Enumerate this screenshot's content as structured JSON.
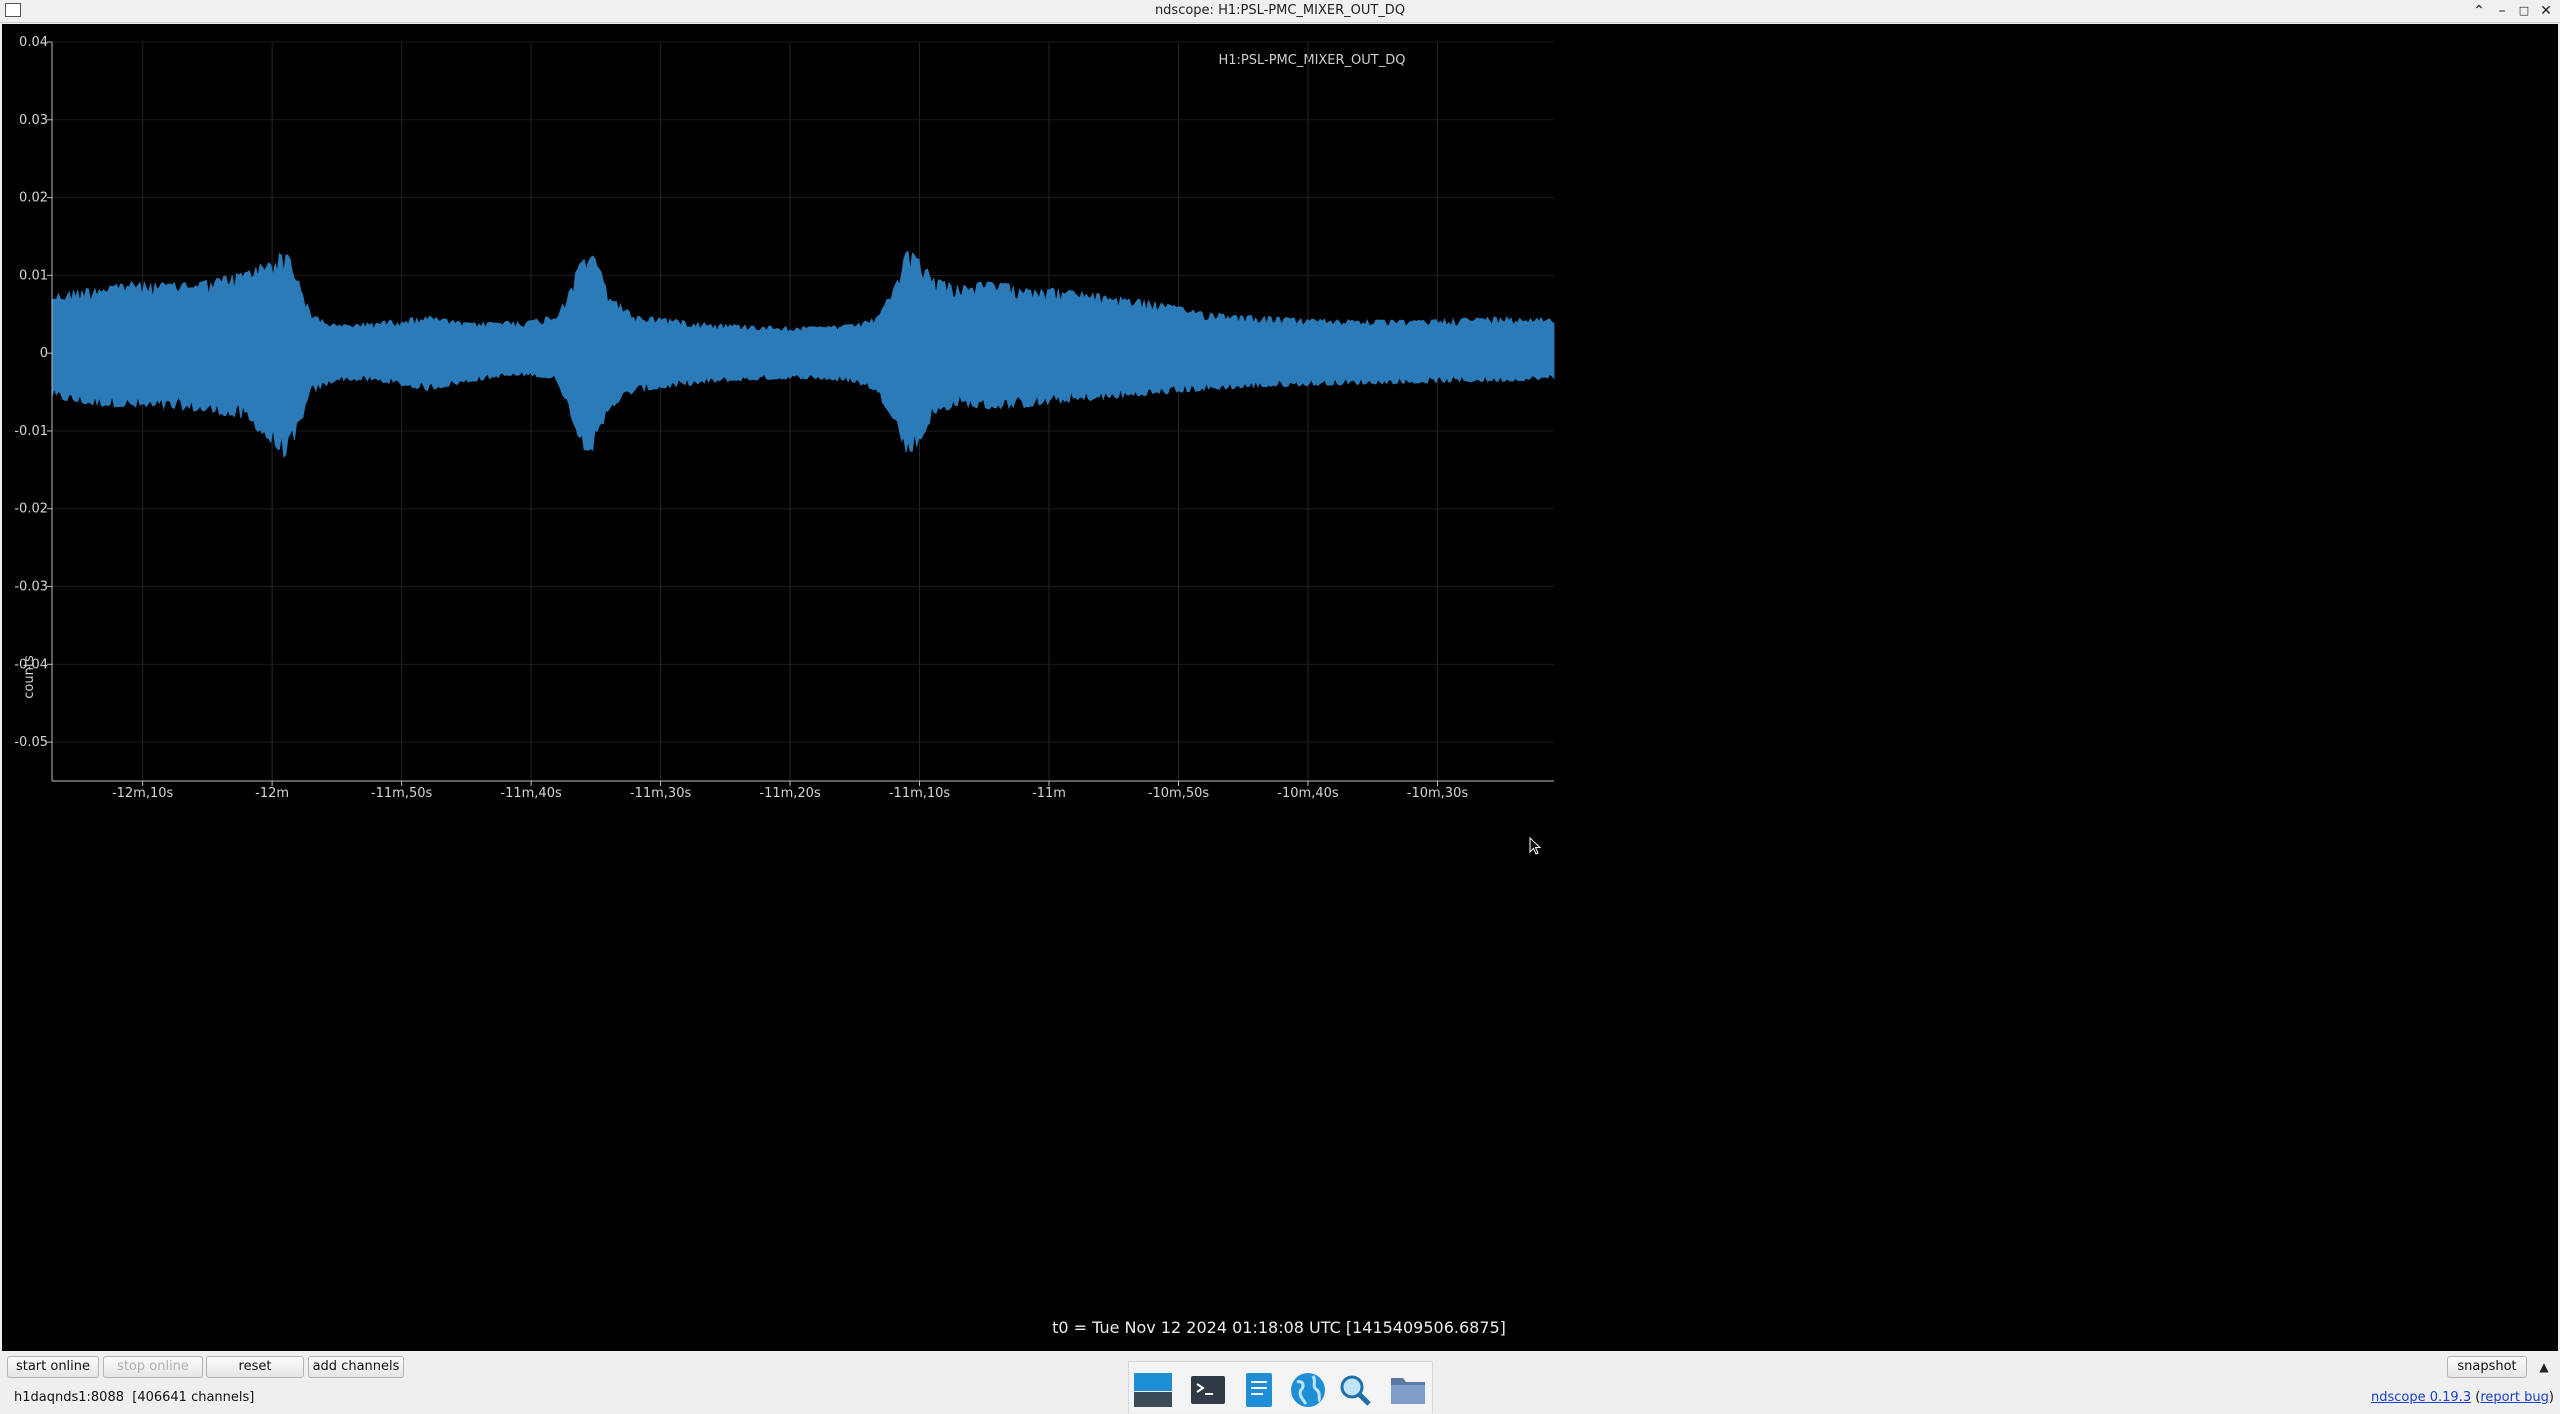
{
  "window": {
    "title": "ndscope: H1:PSL-PMC_MIXER_OUT_DQ"
  },
  "plot": {
    "channel_title": "H1:PSL-PMC_MIXER_OUT_DQ",
    "ylabel": "counts",
    "t0_label": "t0 = Tue Nov 12 2024 01:18:08 UTC [1415409506.6875]",
    "trace_color": "#2b7bb9",
    "background": "#000000"
  },
  "chart_data": {
    "type": "line",
    "title": "H1:PSL-PMC_MIXER_OUT_DQ",
    "ylabel": "counts",
    "xlabel": "t0 = Tue Nov 12 2024 01:18:08 UTC [1415409506.6875]",
    "ylim": [
      -0.055,
      0.04
    ],
    "xlim": [
      -737,
      -621
    ],
    "x_ticks": [
      {
        "value": -730,
        "label": "-12m,10s"
      },
      {
        "value": -720,
        "label": "-12m"
      },
      {
        "value": -710,
        "label": "-11m,50s"
      },
      {
        "value": -700,
        "label": "-11m,40s"
      },
      {
        "value": -690,
        "label": "-11m,30s"
      },
      {
        "value": -680,
        "label": "-11m,20s"
      },
      {
        "value": -670,
        "label": "-11m,10s"
      },
      {
        "value": -660,
        "label": "-11m"
      },
      {
        "value": -650,
        "label": "-10m,50s"
      },
      {
        "value": -640,
        "label": "-10m,40s"
      },
      {
        "value": -630,
        "label": "-10m,30s"
      }
    ],
    "y_ticks": [
      {
        "value": 0.04,
        "label": "0.04"
      },
      {
        "value": 0.03,
        "label": "0.03"
      },
      {
        "value": 0.02,
        "label": "0.02"
      },
      {
        "value": 0.01,
        "label": "0.01"
      },
      {
        "value": 0,
        "label": "0"
      },
      {
        "value": -0.01,
        "label": "-0.01"
      },
      {
        "value": -0.02,
        "label": "-0.02"
      },
      {
        "value": -0.03,
        "label": "-0.03"
      },
      {
        "value": -0.04,
        "label": "-0.04"
      },
      {
        "value": -0.05,
        "label": "-0.05"
      }
    ],
    "grid": true,
    "envelope": {
      "x": [
        -737,
        -734,
        -731,
        -728,
        -725,
        -722,
        -720,
        -719,
        -718.5,
        -717,
        -715,
        -712,
        -708,
        -705,
        -702,
        -700,
        -698,
        -697,
        -696,
        -695,
        -694,
        -692,
        -690,
        -686,
        -682,
        -678,
        -675,
        -673.5,
        -672,
        -671,
        -670,
        -669,
        -667,
        -665,
        -662,
        -659,
        -656,
        -652,
        -648,
        -644,
        -640,
        -636,
        -632,
        -628,
        -624,
        -621
      ],
      "max": [
        0.0075,
        0.0085,
        0.0092,
        0.009,
        0.0094,
        0.0105,
        0.0123,
        0.0132,
        0.012,
        0.005,
        0.0036,
        0.004,
        0.0048,
        0.0039,
        0.0041,
        0.0042,
        0.005,
        0.0085,
        0.0128,
        0.0124,
        0.0076,
        0.0048,
        0.0046,
        0.0038,
        0.0035,
        0.0034,
        0.0037,
        0.0045,
        0.0082,
        0.0132,
        0.0125,
        0.0098,
        0.0087,
        0.0092,
        0.0088,
        0.0082,
        0.0076,
        0.0067,
        0.0053,
        0.0048,
        0.0044,
        0.0043,
        0.0042,
        0.0045,
        0.0047,
        0.0045
      ],
      "min": [
        -0.0058,
        -0.0067,
        -0.007,
        -0.0072,
        -0.0076,
        -0.0086,
        -0.0118,
        -0.0135,
        -0.0128,
        -0.0052,
        -0.0035,
        -0.0036,
        -0.0048,
        -0.0038,
        -0.003,
        -0.0029,
        -0.0035,
        -0.0078,
        -0.0124,
        -0.0126,
        -0.0072,
        -0.005,
        -0.0046,
        -0.0038,
        -0.0034,
        -0.0033,
        -0.0038,
        -0.0048,
        -0.0085,
        -0.0132,
        -0.0118,
        -0.0082,
        -0.0067,
        -0.0072,
        -0.007,
        -0.0064,
        -0.006,
        -0.0054,
        -0.0048,
        -0.0044,
        -0.0042,
        -0.004,
        -0.0039,
        -0.0037,
        -0.0036,
        -0.0033
      ]
    }
  },
  "buttons": {
    "start_online": "start online",
    "stop_online": "stop online",
    "reset": "reset",
    "add_channels": "add channels",
    "snapshot": "snapshot"
  },
  "status": {
    "server": "h1daqnds1:8088",
    "channels": "[406641 channels]"
  },
  "version": {
    "name": "ndscope 0.19.3",
    "open": "(",
    "report": "report bug",
    "close": ")"
  },
  "taskbar": {
    "items": [
      "desktop-icon",
      "terminal-icon",
      "text-editor-icon",
      "web-browser-icon",
      "search-icon",
      "file-manager-icon"
    ]
  }
}
